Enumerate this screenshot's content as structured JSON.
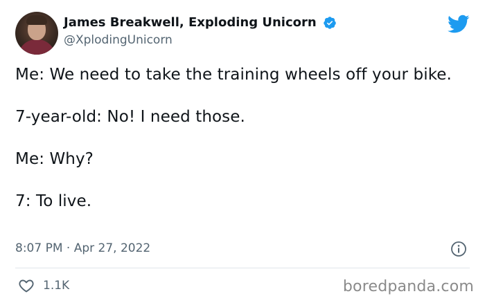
{
  "author": {
    "display_name": "James Breakwell, Exploding Unicorn",
    "handle": "@XplodingUnicorn",
    "verified": true,
    "avatar_icon": "profile-photo"
  },
  "tweet": {
    "lines": [
      "Me: We need to take the training wheels off your bike.",
      "7-year-old: No! I need those.",
      "Me: Why?",
      "7: To live."
    ],
    "time": "8:07 PM",
    "separator": "·",
    "date": "Apr 27, 2022"
  },
  "actions": {
    "like_count": "1.1K",
    "like_icon": "heart-outline-icon",
    "info_icon": "info-icon"
  },
  "brand": {
    "logo_icon": "twitter-bird-icon",
    "twitter_blue": "#1d9bf0"
  },
  "watermark": {
    "text": "boredpanda.com"
  }
}
